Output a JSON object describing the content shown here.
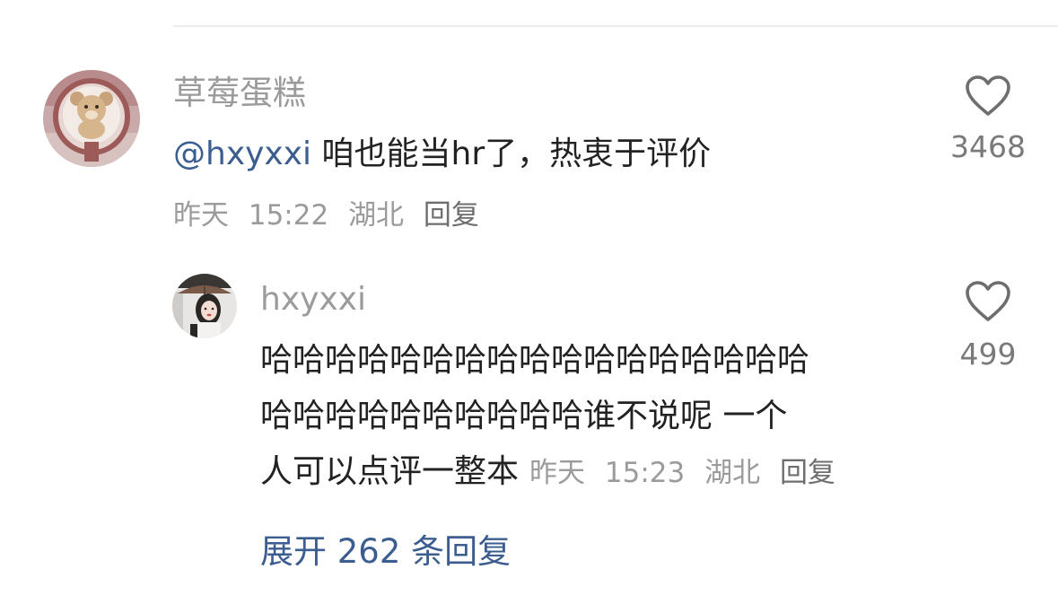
{
  "comment": {
    "username": "草莓蛋糕",
    "mention": "@hxyxxi",
    "text": "咱也能当hr了，热衷于评价",
    "date": "昨天",
    "time": "15:22",
    "location": "湖北",
    "reply_label": "回复",
    "likes": "3468",
    "avatar_icon": "teddy-bear-avatar"
  },
  "reply": {
    "username": "hxyxxi",
    "text_lines": [
      "哈哈哈哈哈哈哈哈哈哈哈哈哈哈哈哈哈",
      "哈哈哈哈哈哈哈哈哈哈谁不说呢 一个",
      "人可以点评一整本"
    ],
    "date": "昨天",
    "time": "15:23",
    "location": "湖北",
    "reply_label": "回复",
    "likes": "499",
    "avatar_icon": "woman-with-umbrella-avatar"
  },
  "expand": {
    "label": "展开 262 条回复"
  },
  "icons": {
    "like": "heart-outline-icon"
  },
  "colors": {
    "mention": "#3b5d8f",
    "secondary_text": "#9b9b9b",
    "primary_text": "#222222"
  }
}
